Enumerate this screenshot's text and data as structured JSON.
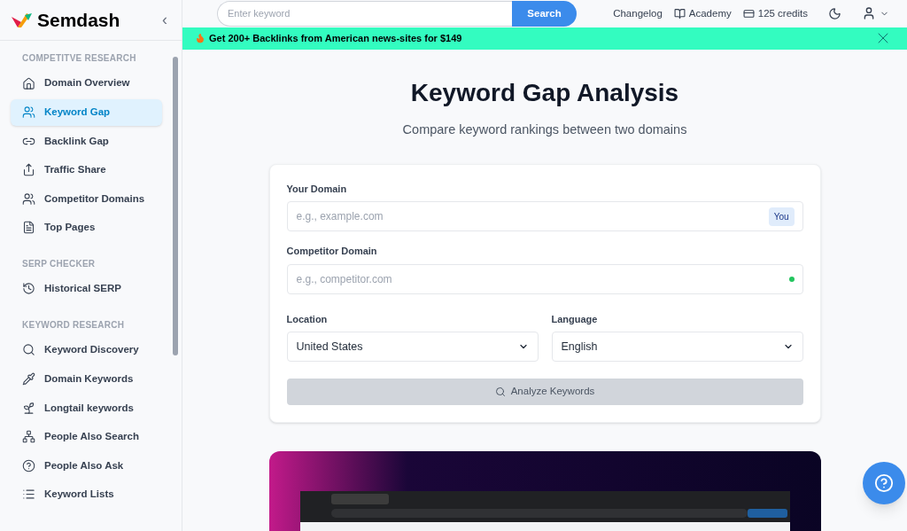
{
  "sidebar": {
    "brand": "Semdash",
    "collapse_icon": "‹",
    "sections": [
      {
        "title": "COMPETITVE RESEARCH",
        "items": [
          {
            "label": "Domain Overview",
            "selected": false
          },
          {
            "label": "Keyword Gap",
            "selected": true
          },
          {
            "label": "Backlink Gap",
            "selected": false
          },
          {
            "label": "Traffic Share",
            "selected": false
          },
          {
            "label": "Competitor Domains",
            "selected": false
          },
          {
            "label": "Top Pages",
            "selected": false
          }
        ]
      },
      {
        "title": "SERP CHECKER",
        "items": [
          {
            "label": "Historical SERP",
            "selected": false
          }
        ]
      },
      {
        "title": "KEYWORD RESEARCH",
        "items": [
          {
            "label": "Keyword Discovery",
            "selected": false
          },
          {
            "label": "Domain Keywords",
            "selected": false
          },
          {
            "label": "Longtail keywords",
            "selected": false
          },
          {
            "label": "People Also Search",
            "selected": false
          },
          {
            "label": "People Also Ask",
            "selected": false
          },
          {
            "label": "Keyword Lists",
            "selected": false
          }
        ]
      }
    ]
  },
  "topbar": {
    "search": {
      "placeholder": "Enter keyword",
      "button": "Search"
    },
    "links": [
      "Changelog",
      "Academy",
      "125 credits"
    ]
  },
  "banner": {
    "text": "Get 200+ Backlinks from American news-sites for $149"
  },
  "main": {
    "title": "Keyword Gap Analysis",
    "subtitle": "Compare keyword rankings between two domains",
    "form": {
      "your_domain": {
        "label": "Your Domain",
        "placeholder": "e.g., example.com",
        "badge": "You"
      },
      "competitor_domain": {
        "label": "Competitor Domain",
        "placeholder": "e.g., competitor.com",
        "color": "#22c55e"
      },
      "location": {
        "label": "Location",
        "value": "United States"
      },
      "language": {
        "label": "Language",
        "value": "English"
      },
      "submit": {
        "label": "Analyze Keywords",
        "disabled": true
      }
    }
  }
}
